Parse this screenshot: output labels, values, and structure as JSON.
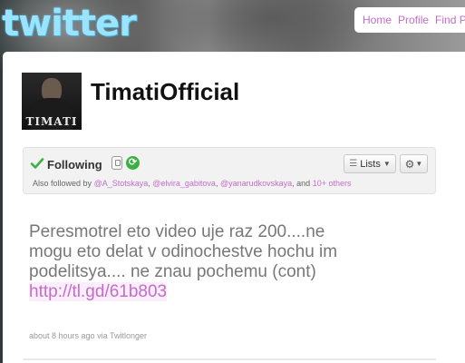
{
  "header": {
    "logo_text": "twitter",
    "nav": [
      "Home",
      "Profile",
      "Find P"
    ]
  },
  "profile": {
    "avatar_text": "TIMATI",
    "username": "TimatiOfficial"
  },
  "follow": {
    "status_label": "Following",
    "lists_label": "Lists",
    "also_prefix": "Also followed by",
    "also_users": [
      "@A_Stotskaya",
      "@elvira_gabitova",
      "@yanarudkovskaya"
    ],
    "also_sep1": ",",
    "also_sep2": ",",
    "also_and": ", and",
    "also_more": "10+ others"
  },
  "tweet": {
    "text": "Peresmotrel eto video uje raz 200....ne mogu eto delat v odinochestve hochu im podelitsya.... ne znau pochemu (cont)",
    "link": "http://tl.gd/61b803",
    "time": "about 8 hours ago",
    "via_prefix": "via",
    "via_app": "Twitlonger"
  },
  "colors": {
    "link": "#c46cc9",
    "logo": "#9ae4ff",
    "following_check": "#3cb043"
  }
}
